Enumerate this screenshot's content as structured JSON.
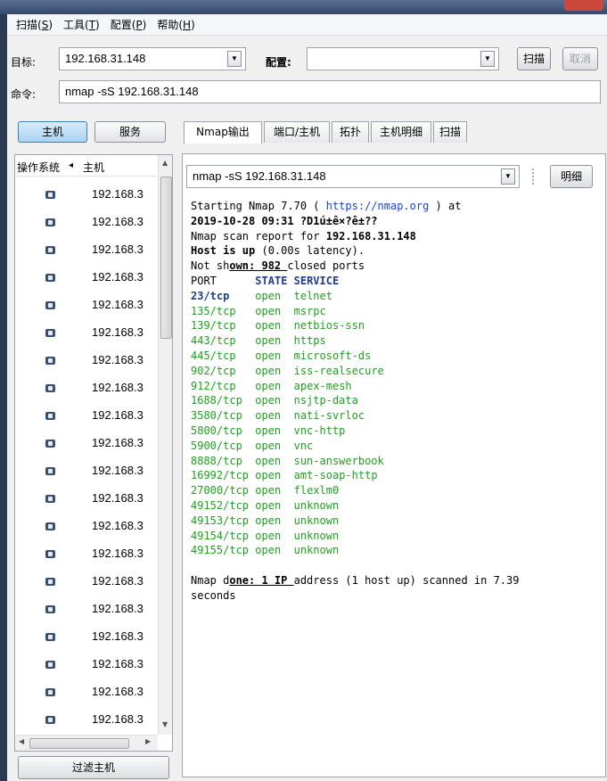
{
  "menu": [
    {
      "label": "扫描(S)",
      "base": "扫描(",
      "key": "S",
      "tail": ")"
    },
    {
      "label": "工具(T)",
      "base": "工具(",
      "key": "T",
      "tail": ")"
    },
    {
      "label": "配置(P)",
      "base": "配置(",
      "key": "P",
      "tail": ")"
    },
    {
      "label": "帮助(H)",
      "base": "帮助(",
      "key": "H",
      "tail": ")"
    }
  ],
  "target": {
    "label": "目标:",
    "value": "192.168.31.148"
  },
  "profile": {
    "label": "配置:",
    "value": ""
  },
  "scan_button": "扫描",
  "cancel_button": "取消",
  "command": {
    "label": "命令:",
    "value": "nmap -sS 192.168.31.148"
  },
  "left_tabs": {
    "hosts": "主机",
    "services": "服务"
  },
  "host_list": {
    "col_os": "操作系统",
    "col_host": "主机",
    "sort_indicator": "◂",
    "rows": [
      "192.168.3",
      "192.168.3",
      "192.168.3",
      "192.168.3",
      "192.168.3",
      "192.168.3",
      "192.168.3",
      "192.168.3",
      "192.168.3",
      "192.168.3",
      "192.168.3",
      "192.168.3",
      "192.168.3",
      "192.168.3",
      "192.168.3",
      "192.168.3",
      "192.168.3",
      "192.168.3",
      "192.168.3",
      "192.168.3"
    ]
  },
  "filter_button": "过滤主机",
  "result_tabs": [
    "Nmap输出",
    "端口/主机",
    "拓扑",
    "主机明细",
    "扫描"
  ],
  "output_select": {
    "value": "nmap -sS 192.168.31.148"
  },
  "details_button": "明细",
  "output": {
    "start_prefix": "Starting Nmap 7.70 ( ",
    "start_link": "https://nmap.org",
    "start_suffix": " ) at",
    "date_line": "2019-10-28 09:31 ?D1ú±ê×?ê±??",
    "report_prefix": "Nmap scan report for ",
    "report_ip": "192.168.31.148",
    "host_up_bold": "Host is up",
    "host_up_rest": " (0.00s latency).",
    "not_shown_a": "Not sh",
    "not_shown_b": "own: 982 ",
    "not_shown_c": "closed ports",
    "header_port": "PORT",
    "header_rest": "STATE SERVICE",
    "ports": [
      {
        "port": "23/tcp",
        "state": "open",
        "service": "telnet"
      },
      {
        "port": "135/tcp",
        "state": "open",
        "service": "msrpc"
      },
      {
        "port": "139/tcp",
        "state": "open",
        "service": "netbios-ssn"
      },
      {
        "port": "443/tcp",
        "state": "open",
        "service": "https"
      },
      {
        "port": "445/tcp",
        "state": "open",
        "service": "microsoft-ds"
      },
      {
        "port": "902/tcp",
        "state": "open",
        "service": "iss-realsecure"
      },
      {
        "port": "912/tcp",
        "state": "open",
        "service": "apex-mesh"
      },
      {
        "port": "1688/tcp",
        "state": "open",
        "service": "nsjtp-data"
      },
      {
        "port": "3580/tcp",
        "state": "open",
        "service": "nati-svrloc"
      },
      {
        "port": "5800/tcp",
        "state": "open",
        "service": "vnc-http"
      },
      {
        "port": "5900/tcp",
        "state": "open",
        "service": "vnc"
      },
      {
        "port": "8888/tcp",
        "state": "open",
        "service": "sun-answerbook"
      },
      {
        "port": "16992/tcp",
        "state": "open",
        "service": "amt-soap-http"
      },
      {
        "port": "27000/tcp",
        "state": "open",
        "service": "flexlm0"
      },
      {
        "port": "49152/tcp",
        "state": "open",
        "service": "unknown"
      },
      {
        "port": "49153/tcp",
        "state": "open",
        "service": "unknown"
      },
      {
        "port": "49154/tcp",
        "state": "open",
        "service": "unknown"
      },
      {
        "port": "49155/tcp",
        "state": "open",
        "service": "unknown"
      }
    ],
    "done_a": "Nmap d",
    "done_b": "one: 1 IP ",
    "done_c": "address (1 host up) scanned in 7.39",
    "done_d": "seconds"
  }
}
